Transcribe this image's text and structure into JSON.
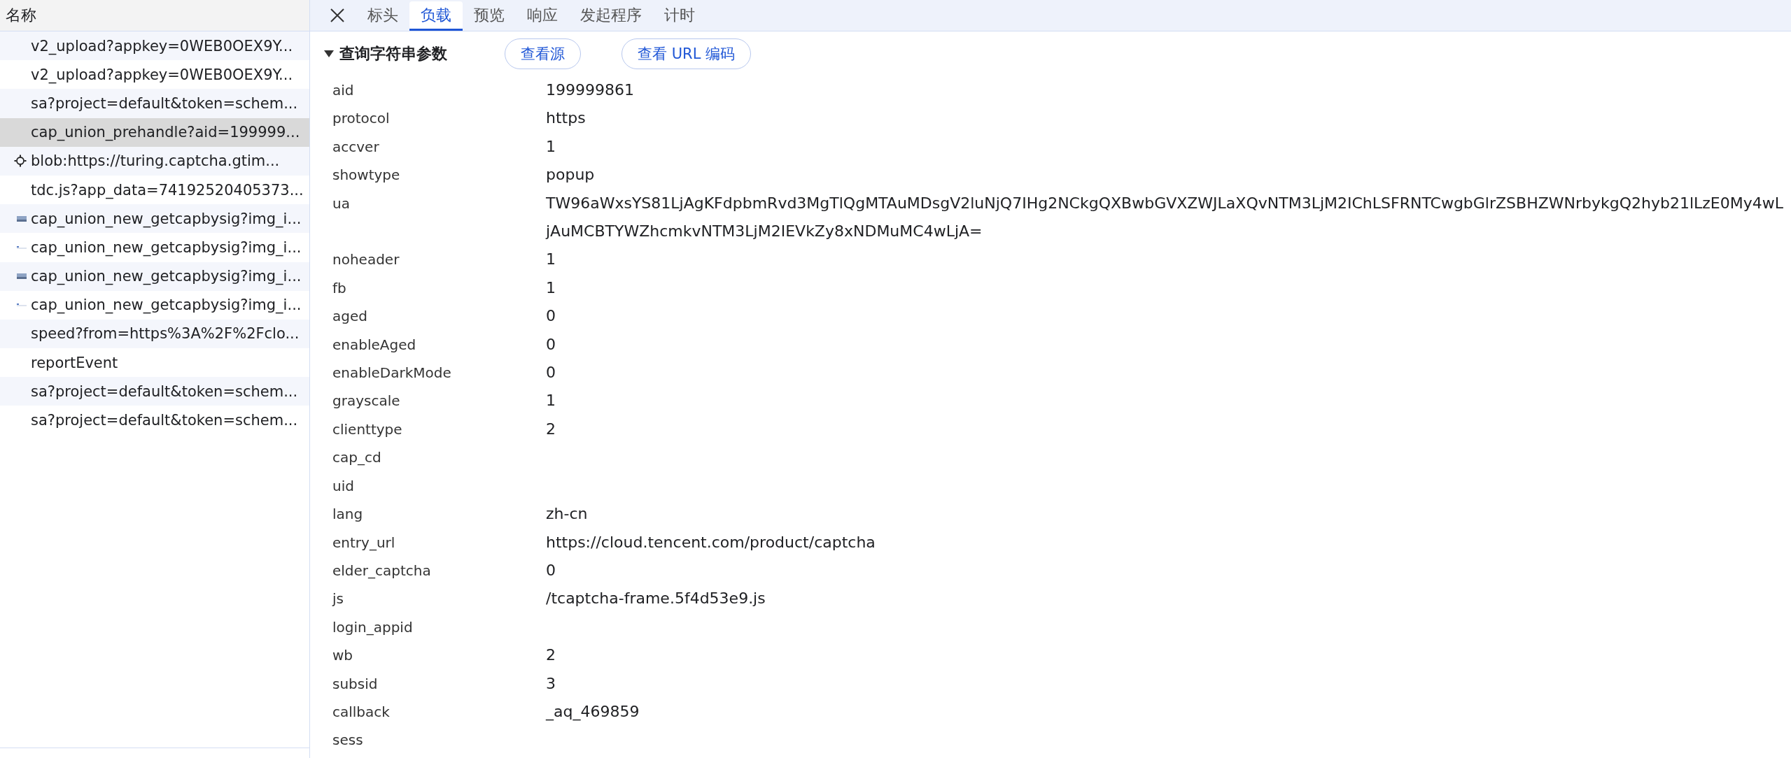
{
  "requests": {
    "header": "名称",
    "rows": [
      {
        "name": "v2_upload?appkey=0WEB0OEX9Y...",
        "kind": "fetch",
        "selected": false
      },
      {
        "name": "v2_upload?appkey=0WEB0OEX9Y...",
        "kind": "fetch",
        "selected": false
      },
      {
        "name": "sa?project=default&token=schem...",
        "kind": "fetch",
        "selected": false
      },
      {
        "name": "cap_union_prehandle?aid=199999...",
        "kind": "fetch",
        "selected": true
      },
      {
        "name": "blob:https://turing.captcha.gtim...",
        "kind": "worker",
        "selected": false
      },
      {
        "name": "tdc.js?app_data=74192520405373...",
        "kind": "fetch",
        "selected": false
      },
      {
        "name": "cap_union_new_getcapbysig?img_i...",
        "kind": "image",
        "selected": false
      },
      {
        "name": "cap_union_new_getcapbysig?img_i...",
        "kind": "slice",
        "selected": false
      },
      {
        "name": "cap_union_new_getcapbysig?img_i...",
        "kind": "image",
        "selected": false
      },
      {
        "name": "cap_union_new_getcapbysig?img_i...",
        "kind": "slice",
        "selected": false
      },
      {
        "name": "speed?from=https%3A%2F%2Fclo...",
        "kind": "fetch",
        "selected": false
      },
      {
        "name": "reportEvent",
        "kind": "fetch",
        "selected": false
      },
      {
        "name": "sa?project=default&token=schem...",
        "kind": "fetch",
        "selected": false
      },
      {
        "name": "sa?project=default&token=schem...",
        "kind": "fetch",
        "selected": false
      }
    ]
  },
  "tabs": [
    {
      "label": "标头",
      "selected": false
    },
    {
      "label": "负载",
      "selected": true
    },
    {
      "label": "预览",
      "selected": false
    },
    {
      "label": "响应",
      "selected": false
    },
    {
      "label": "发起程序",
      "selected": false
    },
    {
      "label": "计时",
      "selected": false
    }
  ],
  "section": {
    "title": "查询字符串参数",
    "expanded": true,
    "buttons": [
      "查看源",
      "查看 URL 编码"
    ],
    "params": [
      {
        "key": "aid",
        "value": "199999861"
      },
      {
        "key": "protocol",
        "value": "https"
      },
      {
        "key": "accver",
        "value": "1"
      },
      {
        "key": "showtype",
        "value": "popup"
      },
      {
        "key": "ua",
        "value": "TW96aWxsYS81LjAgKFdpbmRvd3MgTlQgMTAuMDsgV2luNjQ7IHg2NCkgQXBwbGVXZWJLaXQvNTM3LjM2IChLSFRNTCwgbGlrZSBHZWNrbykgQ2hyb21lLzE0My4wLjAuMCBTYWZhcmkvNTM3LjM2IEVkZy8xNDMuMC4wLjA="
      },
      {
        "key": "noheader",
        "value": "1"
      },
      {
        "key": "fb",
        "value": "1"
      },
      {
        "key": "aged",
        "value": "0"
      },
      {
        "key": "enableAged",
        "value": "0"
      },
      {
        "key": "enableDarkMode",
        "value": "0"
      },
      {
        "key": "grayscale",
        "value": "1"
      },
      {
        "key": "clienttype",
        "value": "2"
      },
      {
        "key": "cap_cd"
      },
      {
        "key": "uid"
      },
      {
        "key": "lang",
        "value": "zh-cn"
      },
      {
        "key": "entry_url",
        "value": "https://cloud.tencent.com/product/captcha"
      },
      {
        "key": "elder_captcha",
        "value": "0"
      },
      {
        "key": "js",
        "value": "/tcaptcha-frame.5f4d53e9.js"
      },
      {
        "key": "login_appid"
      },
      {
        "key": "wb",
        "value": "2"
      },
      {
        "key": "subsid",
        "value": "3"
      },
      {
        "key": "callback",
        "value": "_aq_469859"
      },
      {
        "key": "sess"
      }
    ]
  }
}
